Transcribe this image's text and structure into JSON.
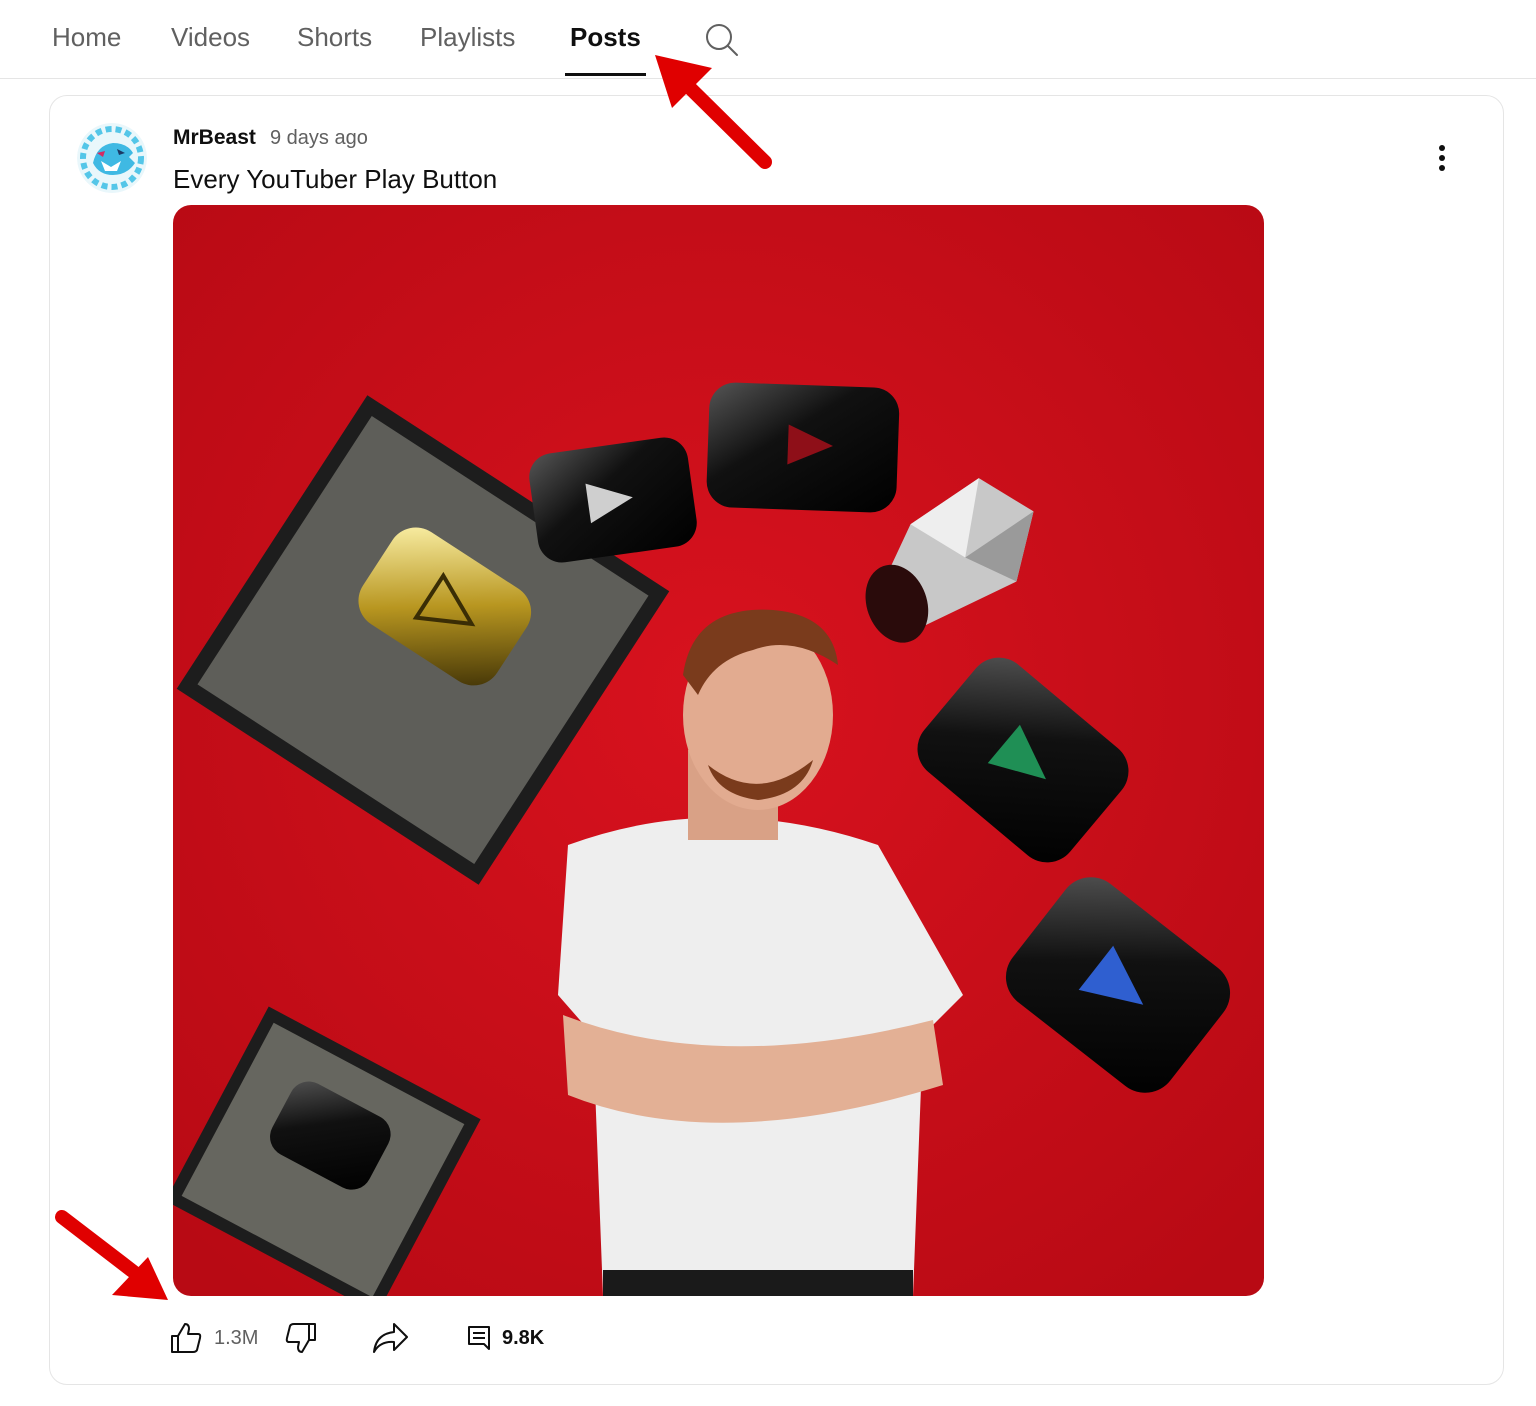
{
  "tabs": [
    {
      "label": "Home"
    },
    {
      "label": "Videos"
    },
    {
      "label": "Shorts"
    },
    {
      "label": "Playlists"
    },
    {
      "label": "Posts",
      "active": true
    }
  ],
  "search": {
    "icon": "search-icon"
  },
  "post": {
    "author": "MrBeast",
    "time": "9 days ago",
    "title": "Every YouTuber Play Button",
    "image_description_icon": "photo",
    "likes": "1.3M",
    "comments": "9.8K"
  },
  "colors": {
    "accent_red": "#e00000",
    "carpet_red": "#c4101a",
    "text": "#0f0f0f",
    "secondary_text": "#606060"
  }
}
